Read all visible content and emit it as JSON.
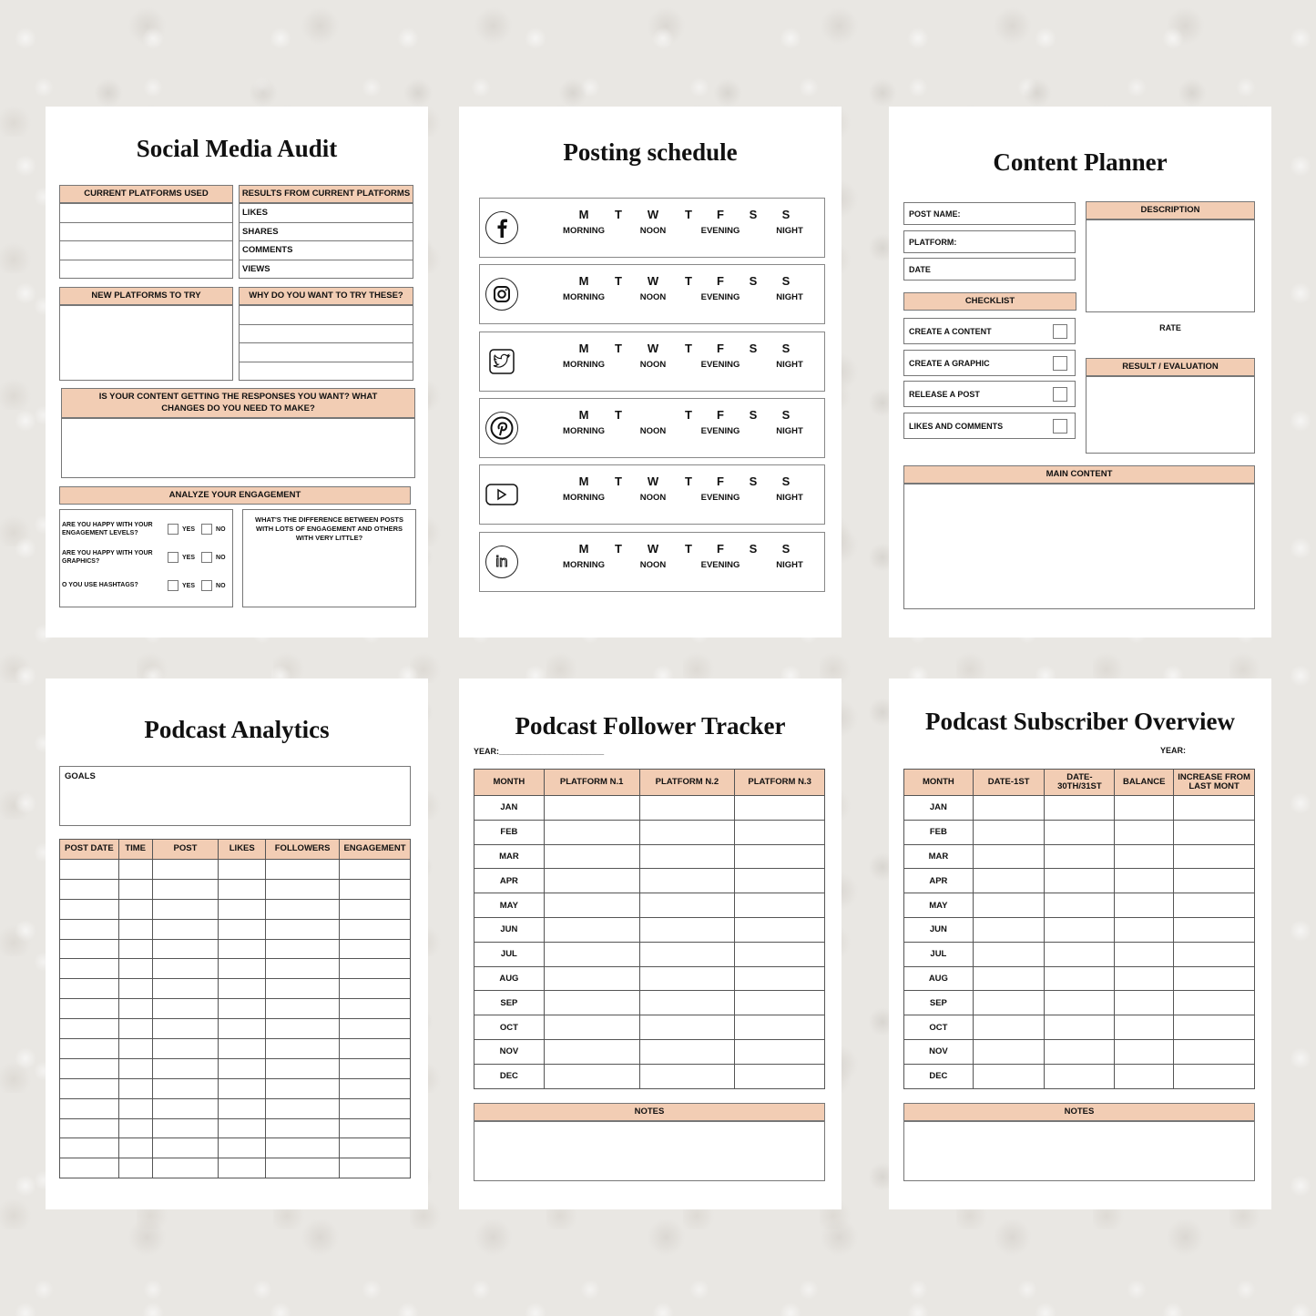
{
  "colors": {
    "header_fill": "#f2cdb4",
    "background": "#e9e7e3"
  },
  "audit": {
    "title": "Social Media Audit",
    "current_platforms": "CURRENT PLATFORMS USED",
    "results": "RESULTS FROM CURRENT PLATFORMS",
    "result_rows": [
      "LIKES",
      "SHARES",
      "COMMENTS",
      "VIEWS"
    ],
    "new_platforms": "NEW PLATFORMS TO TRY",
    "why": "WHY DO YOU WANT TO TRY THESE?",
    "question": "IS YOUR CONTENT GETTING THE RESPONSES YOU WANT? WHAT CHANGES DO YOU NEED TO MAKE?",
    "analyze": "ANALYZE YOUR ENGAGEMENT",
    "questions": [
      "ARE YOU HAPPY WITH YOUR ENGAGEMENT LEVELS?",
      "ARE YOU HAPPY WITH YOUR GRAPHICS?",
      "O YOU USE HASHTAGS?"
    ],
    "yes": "YES",
    "no": "NO",
    "difference": "WHAT'S THE DIFFERENCE BETWEEN POSTS WITH LOTS OF ENGAGEMENT AND OTHERS WITH VERY LITTLE?"
  },
  "schedule": {
    "title": "Posting schedule",
    "rows": [
      {
        "icon": "facebook-icon",
        "days": [
          "M",
          "T",
          "W",
          "T",
          "F",
          "S",
          "S"
        ]
      },
      {
        "icon": "instagram-icon",
        "days": [
          "M",
          "T",
          "W",
          "T",
          "F",
          "S",
          "S"
        ]
      },
      {
        "icon": "twitter-icon",
        "days": [
          "M",
          "T",
          "W",
          "T",
          "F",
          "S",
          "S"
        ]
      },
      {
        "icon": "pinterest-icon",
        "days": [
          "M",
          "T",
          "",
          "T",
          "F",
          "S",
          "S"
        ]
      },
      {
        "icon": "youtube-icon",
        "days": [
          "M",
          "T",
          "W",
          "T",
          "F",
          "S",
          "S"
        ]
      },
      {
        "icon": "linkedin-icon",
        "days": [
          "M",
          "T",
          "W",
          "T",
          "F",
          "S",
          "S"
        ]
      }
    ],
    "times": [
      "MORNING",
      "NOON",
      "EVENING",
      "NIGHT"
    ]
  },
  "planner": {
    "title": "Content Planner",
    "fields": [
      "POST NAME:",
      "PLATFORM:",
      "DATE"
    ],
    "checklist": "CHECKLIST",
    "items": [
      "CREATE A CONTENT",
      "CREATE A GRAPHIC",
      "RELEASE A POST",
      "LIKES AND COMMENTS"
    ],
    "description": "DESCRIPTION",
    "rate": "RATE",
    "result": "RESULT / EVALUATION",
    "main": "MAIN CONTENT"
  },
  "analytics": {
    "title": "Podcast Analytics",
    "goals": "GOALS",
    "columns": [
      "POST DATE",
      "TIME",
      "POST",
      "LIKES",
      "FOLLOWERS",
      "ENGAGEMENT"
    ]
  },
  "follower": {
    "title": "Podcast Follower Tracker",
    "year": "YEAR:_______________________",
    "columns": [
      "MONTH",
      "PLATFORM N.1",
      "PLATFORM N.2",
      "PLATFORM N.3"
    ],
    "notes": "NOTES"
  },
  "subscriber": {
    "title": "Podcast Subscriber Overview",
    "year": "YEAR:",
    "columns": [
      "MONTH",
      "DATE-1ST",
      "DATE-30TH/31ST",
      "BALANCE",
      "INCREASE FROM LAST MONT"
    ],
    "notes": "NOTES"
  },
  "months": [
    "JAN",
    "FEB",
    "MAR",
    "APR",
    "MAY",
    "JUN",
    "JUL",
    "AUG",
    "SEP",
    "OCT",
    "NOV",
    "DEC"
  ]
}
